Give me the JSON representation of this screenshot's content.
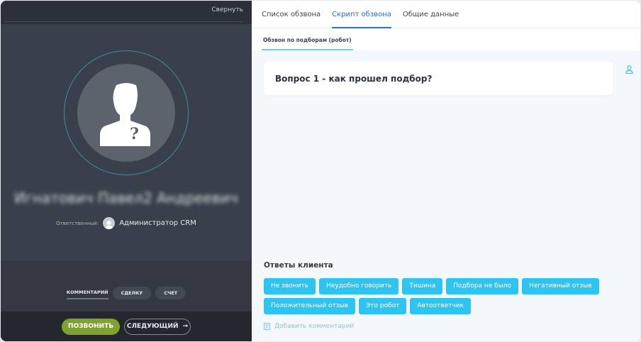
{
  "left_panel": {
    "collapse_label": "Свернуть",
    "contact_name": "Игнатович Павел2 Андреевич",
    "responsible_label": "Ответственный:",
    "responsible_value": "Администратор CRM",
    "action_tabs": [
      "КОММЕНТАРИЙ",
      "СДЕЛКУ",
      "СЧЕТ"
    ],
    "call_button": "ПОЗВОНИТЬ",
    "next_button": "СЛЕДУЮЩИЙ",
    "next_arrow": "→"
  },
  "tabs": [
    "Список обзвона",
    "Скрипт обзвона",
    "Общие данные"
  ],
  "subtab": "Обзвон по подборам (робот)",
  "question": "Вопрос 1 - как прошел подбор?",
  "answers_title": "Ответы клиента",
  "answers": [
    "Не звонить",
    "Неудобно говорить",
    "Тишина",
    "Подбора не было",
    "Негативный отзыв",
    "Положительный отзыв",
    "Это робот",
    "Автоответчик"
  ],
  "add_comment": "Добавить комментарий",
  "colors": {
    "accent": "#2a6fd6",
    "answer": "#2ec4f2",
    "call": "#7fa12e"
  }
}
